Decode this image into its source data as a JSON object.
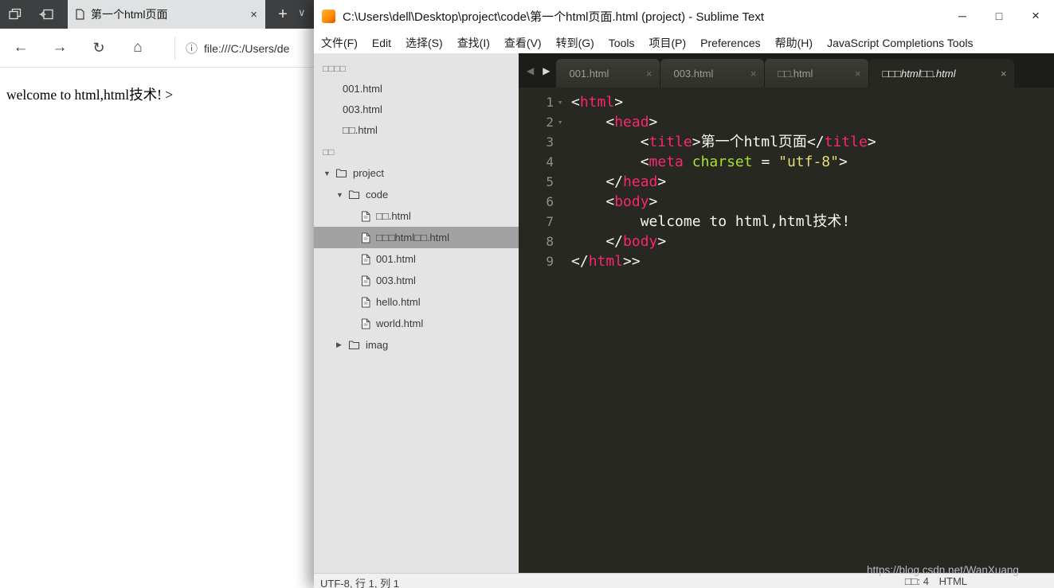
{
  "colors": {
    "editor_bg": "#272822",
    "tag": "#f92672",
    "attribute": "#a6e22e",
    "string": "#e6db74",
    "plain_text": "#f8f8f2",
    "line_number": "#8f908a",
    "sidebar_bg": "#e4e4e4",
    "selected_row": "#a2a2a2",
    "browser_tabstrip": "#3d3f41"
  },
  "icons": {
    "back": "←",
    "forward": "→",
    "refresh": "↻",
    "home": "⌂",
    "info": "ⓘ",
    "new_tab": "+",
    "tab_close": "×",
    "minimize": "─",
    "maximize": "□",
    "close": "×",
    "fold": "▾",
    "expanded": "▼",
    "collapsed": "▶",
    "nav_left": "◀",
    "nav_right": "▶",
    "chevron_down": "∨"
  },
  "browser": {
    "tab_title": "第一个html页面",
    "url": "file:///C:/Users/de",
    "page_text": "welcome to html,html技术! >"
  },
  "sublime": {
    "window_title": "C:\\Users\\dell\\Desktop\\project\\code\\第一个html页面.html (project) - Sublime Text",
    "menu": [
      "文件(F)",
      "Edit",
      "选择(S)",
      "查找(I)",
      "查看(V)",
      "转到(G)",
      "Tools",
      "项目(P)",
      "Preferences",
      "帮助(H)",
      "JavaScript Completions Tools"
    ],
    "sidebar": {
      "open_files_header": "□□□□",
      "open_files": [
        "001.html",
        "003.html",
        "□□.html"
      ],
      "folders_header": "□□",
      "tree": [
        {
          "label": "project",
          "type": "folder",
          "depth": 0,
          "expanded": true
        },
        {
          "label": "code",
          "type": "folder",
          "depth": 1,
          "expanded": true
        },
        {
          "label": "□□.html",
          "type": "file",
          "depth": 2
        },
        {
          "label": "□□□html□□.html",
          "type": "file",
          "depth": 2,
          "selected": true
        },
        {
          "label": "001.html",
          "type": "file",
          "depth": 2
        },
        {
          "label": "003.html",
          "type": "file",
          "depth": 2
        },
        {
          "label": "hello.html",
          "type": "file",
          "depth": 2
        },
        {
          "label": "world.html",
          "type": "file",
          "depth": 2
        },
        {
          "label": "imag",
          "type": "folder",
          "depth": 1,
          "expanded": false
        }
      ]
    },
    "tabs": [
      {
        "label": "001.html",
        "active": false
      },
      {
        "label": "003.html",
        "active": false
      },
      {
        "label": "□□.html",
        "active": false
      },
      {
        "label": "□□□html□□.html",
        "active": true
      }
    ],
    "code_lines": [
      {
        "num": "1",
        "fold": true,
        "tokens": [
          {
            "t": "<",
            "c": "p"
          },
          {
            "t": "html",
            "c": "t"
          },
          {
            "t": ">",
            "c": "p"
          }
        ]
      },
      {
        "num": "2",
        "fold": true,
        "tokens": [
          {
            "t": "    <",
            "c": "p"
          },
          {
            "t": "head",
            "c": "t"
          },
          {
            "t": ">",
            "c": "p"
          }
        ]
      },
      {
        "num": "3",
        "fold": false,
        "tokens": [
          {
            "t": "        <",
            "c": "p"
          },
          {
            "t": "title",
            "c": "t"
          },
          {
            "t": ">",
            "c": "p"
          },
          {
            "t": "第一个html页面",
            "c": "p"
          },
          {
            "t": "</",
            "c": "p"
          },
          {
            "t": "title",
            "c": "t"
          },
          {
            "t": ">",
            "c": "p"
          }
        ]
      },
      {
        "num": "4",
        "fold": false,
        "tokens": [
          {
            "t": "        <",
            "c": "p"
          },
          {
            "t": "meta",
            "c": "t"
          },
          {
            "t": " ",
            "c": "p"
          },
          {
            "t": "charset",
            "c": "a"
          },
          {
            "t": " = ",
            "c": "p"
          },
          {
            "t": "\"utf-8\"",
            "c": "s"
          },
          {
            "t": ">",
            "c": "p"
          }
        ]
      },
      {
        "num": "5",
        "fold": false,
        "tokens": [
          {
            "t": "    </",
            "c": "p"
          },
          {
            "t": "head",
            "c": "t"
          },
          {
            "t": ">",
            "c": "p"
          }
        ]
      },
      {
        "num": "6",
        "fold": false,
        "tokens": [
          {
            "t": "    <",
            "c": "p"
          },
          {
            "t": "body",
            "c": "t"
          },
          {
            "t": ">",
            "c": "p"
          }
        ]
      },
      {
        "num": "7",
        "fold": false,
        "tokens": [
          {
            "t": "        welcome to html,html技术!",
            "c": "p"
          }
        ]
      },
      {
        "num": "8",
        "fold": false,
        "tokens": [
          {
            "t": "    </",
            "c": "p"
          },
          {
            "t": "body",
            "c": "t"
          },
          {
            "t": ">",
            "c": "p"
          }
        ]
      },
      {
        "num": "9",
        "fold": false,
        "tokens": [
          {
            "t": "</",
            "c": "p"
          },
          {
            "t": "html",
            "c": "t"
          },
          {
            "t": ">>",
            "c": "p"
          }
        ]
      }
    ],
    "status": {
      "left": "UTF-8, 行 1, 列 1",
      "tab_size": "□□: 4",
      "syntax": "HTML"
    }
  },
  "watermark": "https://blog.csdn.net/WanXuang"
}
